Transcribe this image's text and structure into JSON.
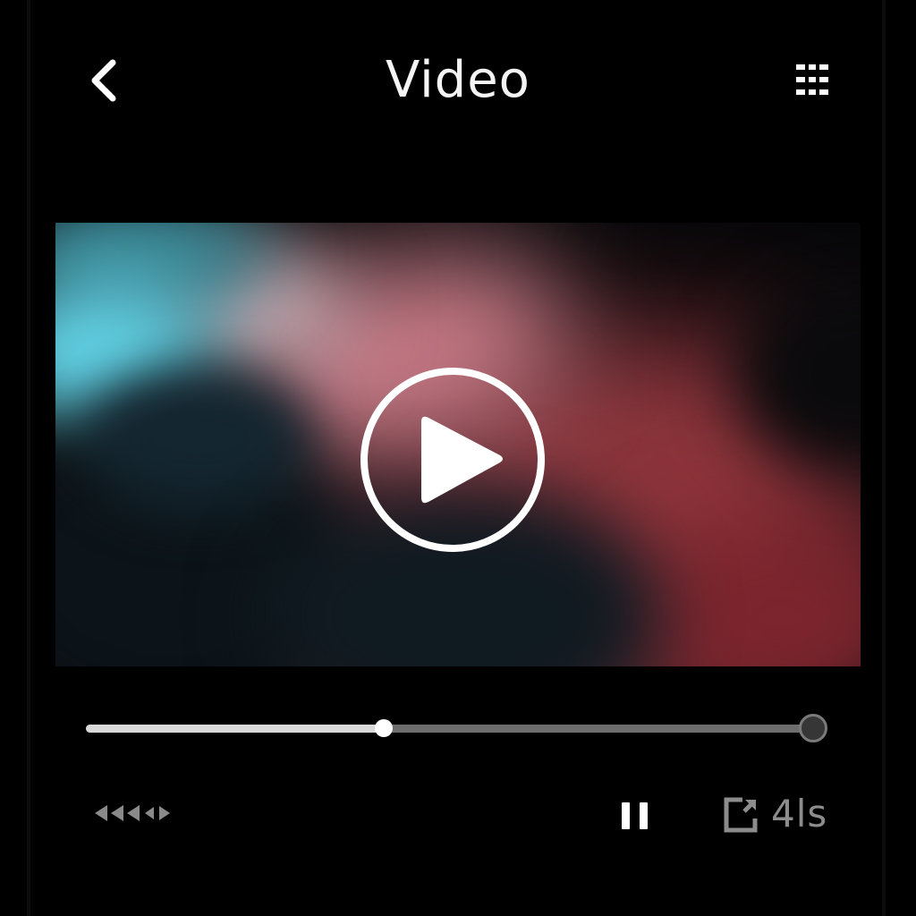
{
  "header": {
    "title": "Video",
    "back_icon": "chevron-left-icon",
    "menu_icon": "grid-menu-icon"
  },
  "player": {
    "center_icon": "play-circle-icon",
    "progress_fraction": 0.41,
    "duration_label": "4ls"
  },
  "controls": {
    "seek_icon": "rewind-forward-icon",
    "pause_icon": "pause-icon",
    "fullscreen_icon": "fullscreen-icon"
  },
  "colors": {
    "background": "#000000",
    "foreground": "#f4f4f4",
    "progress_filled": "#d9d9d9",
    "progress_track": "#6d6d6d",
    "muted_text": "#8c8c8c"
  }
}
